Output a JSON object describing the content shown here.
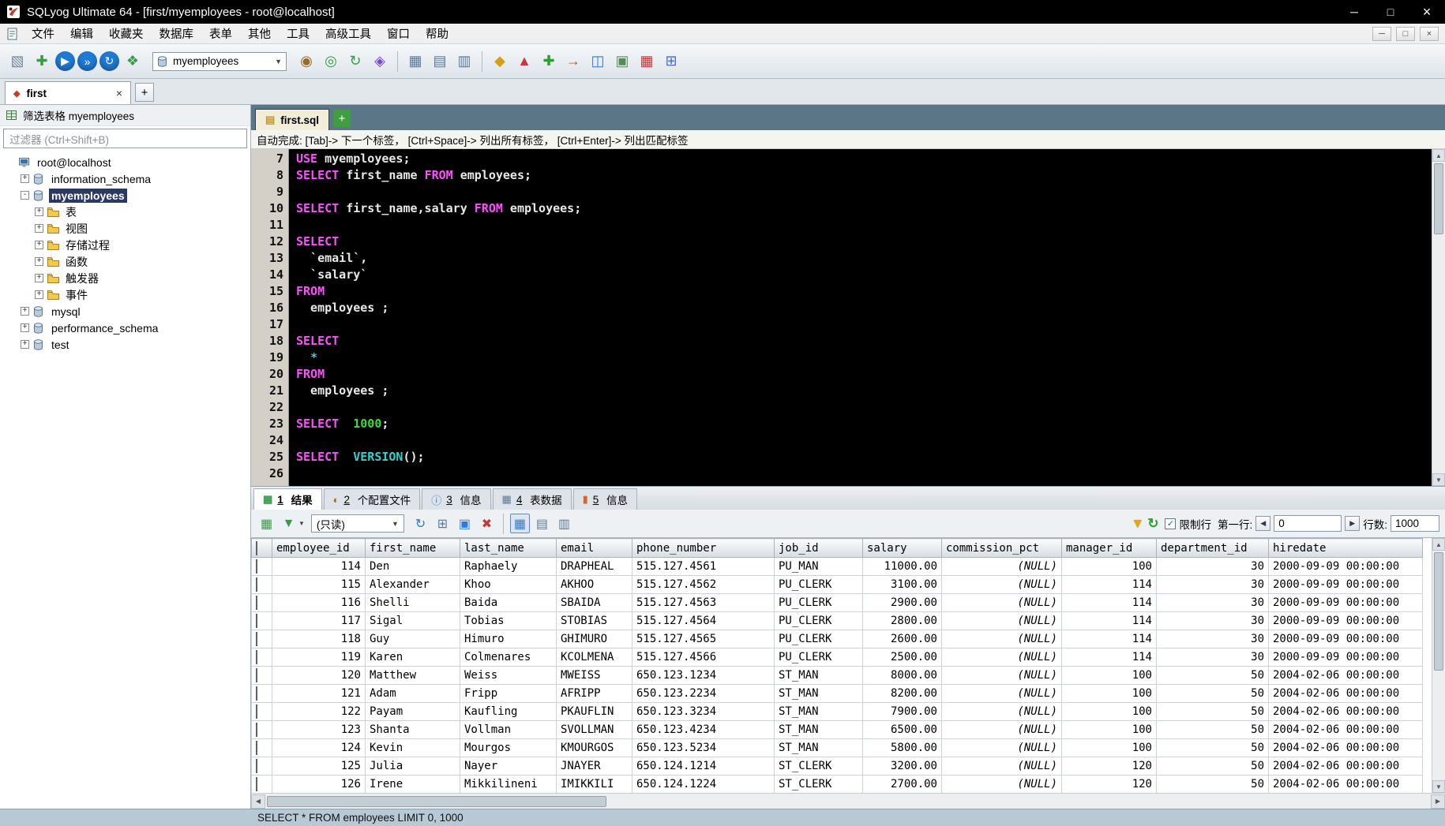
{
  "window": {
    "title": "SQLyog Ultimate 64 - [first/myemployees - root@localhost]",
    "controls": {
      "minimize": "─",
      "restore": "□",
      "close": "×"
    }
  },
  "menu": {
    "items": [
      "文件",
      "编辑",
      "收藏夹",
      "数据库",
      "表单",
      "其他",
      "工具",
      "高级工具",
      "窗口",
      "帮助"
    ]
  },
  "toolbar": {
    "db_selector": "myemployees",
    "left_icons": [
      {
        "name": "connection-manager-icon",
        "g": "▧",
        "c": "#76869a"
      },
      {
        "name": "new-query-editor-icon",
        "g": "✚",
        "c": "#3a9a4a"
      },
      {
        "name": "execute-query-icon",
        "g": "▶",
        "c": "#1f7ad4",
        "shape": "circle"
      },
      {
        "name": "execute-all-queries-icon",
        "g": "»",
        "c": "#1f7ad4",
        "shape": "circle"
      },
      {
        "name": "refresh-connection-icon",
        "g": "↻",
        "c": "#1f7ad4",
        "shape": "circle"
      },
      {
        "name": "user-manager-icon",
        "g": "❖",
        "c": "#3a9a4a"
      }
    ],
    "right_icons": [
      {
        "name": "query-profiler-icon",
        "g": "◉",
        "c": "#9a6a2a"
      },
      {
        "name": "connect-database-icon",
        "g": "◎",
        "c": "#3a9a4a"
      },
      {
        "name": "refresh-database-icon",
        "g": "↻",
        "c": "#3a9a4a"
      },
      {
        "name": "export-database-icon",
        "g": "◈",
        "c": "#7a4ad0"
      },
      {
        "sep": true
      },
      {
        "name": "create-table-icon",
        "g": "▦",
        "c": "#5a7a99"
      },
      {
        "name": "alter-table-icon",
        "g": "▤",
        "c": "#5a7a99"
      },
      {
        "name": "copy-table-icon",
        "g": "▥",
        "c": "#5a7a99"
      },
      {
        "sep": true
      },
      {
        "name": "query-builder-icon",
        "g": "◆",
        "c": "#d4a017"
      },
      {
        "name": "schema-designer-icon",
        "g": "▲",
        "c": "#c23a3a"
      },
      {
        "name": "data-sync-icon",
        "g": "✚",
        "c": "#2e9e2e"
      },
      {
        "name": "schema-sync-icon",
        "g": "→",
        "c": "#a0622a"
      },
      {
        "name": "visual-compare-icon",
        "g": "◫",
        "c": "#2e7ad4"
      },
      {
        "name": "notifications-icon",
        "g": "▣",
        "c": "#5a8a5a"
      },
      {
        "name": "scheduled-backup-icon",
        "g": "▦",
        "c": "#c23a3a"
      },
      {
        "name": "table-diagnostics-icon",
        "g": "⊞",
        "c": "#4a6acc"
      }
    ]
  },
  "session_tabs": {
    "tabs": [
      {
        "label": "first"
      }
    ],
    "new_tab": "+"
  },
  "sidebar": {
    "filter_label": "筛选表格 myemployees",
    "filter_placeholder": "过滤器 (Ctrl+Shift+B)",
    "tree": [
      {
        "label": "root@localhost",
        "type": "connection",
        "level": 0,
        "expand": ""
      },
      {
        "label": "information_schema",
        "type": "database",
        "level": 1,
        "expand": "+"
      },
      {
        "label": "myemployees",
        "type": "database",
        "level": 1,
        "expand": "-",
        "selected": true
      },
      {
        "label": "表",
        "type": "folder",
        "level": 2,
        "expand": "+"
      },
      {
        "label": "视图",
        "type": "folder",
        "level": 2,
        "expand": "+"
      },
      {
        "label": "存储过程",
        "type": "folder",
        "level": 2,
        "expand": "+"
      },
      {
        "label": "函数",
        "type": "folder",
        "level": 2,
        "expand": "+"
      },
      {
        "label": "触发器",
        "type": "folder",
        "level": 2,
        "expand": "+"
      },
      {
        "label": "事件",
        "type": "folder",
        "level": 2,
        "expand": "+"
      },
      {
        "label": "mysql",
        "type": "database",
        "level": 1,
        "expand": "+"
      },
      {
        "label": "performance_schema",
        "type": "database",
        "level": 1,
        "expand": "+"
      },
      {
        "label": "test",
        "type": "database",
        "level": 1,
        "expand": "+"
      }
    ]
  },
  "editor": {
    "tab_label": "first.sql",
    "new_tab": "+",
    "hint": "自动完成:  [Tab]-> 下一个标签， [Ctrl+Space]-> 列出所有标签， [Ctrl+Enter]-> 列出匹配标签",
    "token_colors": {
      "keyword": "#ff50ff",
      "text": "#e8e8e8",
      "number": "#3ddc3d",
      "function": "#2fd2d2"
    },
    "lines": [
      {
        "n": 7,
        "t": [
          [
            "kw",
            "USE"
          ],
          [
            "tx",
            " myemployees;"
          ]
        ]
      },
      {
        "n": 8,
        "t": [
          [
            "kw",
            "SELECT"
          ],
          [
            "tx",
            " first_name "
          ],
          [
            "kw",
            "FROM"
          ],
          [
            "tx",
            " employees;"
          ]
        ]
      },
      {
        "n": 9,
        "t": []
      },
      {
        "n": 10,
        "t": [
          [
            "kw",
            "SELECT"
          ],
          [
            "tx",
            " first_name,salary "
          ],
          [
            "kw",
            "FROM"
          ],
          [
            "tx",
            " employees;"
          ]
        ]
      },
      {
        "n": 11,
        "t": []
      },
      {
        "n": 12,
        "t": [
          [
            "kw",
            "SELECT"
          ]
        ]
      },
      {
        "n": 13,
        "t": [
          [
            "tx",
            "  `email`,"
          ]
        ]
      },
      {
        "n": 14,
        "t": [
          [
            "tx",
            "  `salary`"
          ]
        ]
      },
      {
        "n": 15,
        "t": [
          [
            "kw",
            "FROM"
          ]
        ]
      },
      {
        "n": 16,
        "t": [
          [
            "tx",
            "  employees ;"
          ]
        ]
      },
      {
        "n": 17,
        "t": []
      },
      {
        "n": 18,
        "t": [
          [
            "kw",
            "SELECT"
          ]
        ]
      },
      {
        "n": 19,
        "t": [
          [
            "tx",
            "  "
          ],
          [
            "st",
            "*"
          ]
        ]
      },
      {
        "n": 20,
        "t": [
          [
            "kw",
            "FROM"
          ]
        ]
      },
      {
        "n": 21,
        "t": [
          [
            "tx",
            "  employees ;"
          ]
        ]
      },
      {
        "n": 22,
        "t": []
      },
      {
        "n": 23,
        "t": [
          [
            "kw",
            "SELECT"
          ],
          [
            "tx",
            "  "
          ],
          [
            "num",
            "1000"
          ],
          [
            "tx",
            ";"
          ]
        ]
      },
      {
        "n": 24,
        "t": []
      },
      {
        "n": 25,
        "t": [
          [
            "kw",
            "SELECT"
          ],
          [
            "tx",
            "  "
          ],
          [
            "fn",
            "VERSION"
          ],
          [
            "tx",
            "();"
          ]
        ]
      },
      {
        "n": 26,
        "t": []
      }
    ]
  },
  "results": {
    "tabs": [
      {
        "num": "1",
        "label": "结果",
        "icon_g": "▦",
        "icon_c": "#3a9a4a",
        "active": true
      },
      {
        "num": "2",
        "label": "个配置文件",
        "icon_g": "◐",
        "icon_c": "#9a6a2a"
      },
      {
        "num": "3",
        "label": "信息",
        "icon_g": "ⓘ",
        "icon_c": "#2e7ad4"
      },
      {
        "num": "4",
        "label": "表数据",
        "icon_g": "▦",
        "icon_c": "#5a7a99"
      },
      {
        "num": "5",
        "label": "信息",
        "icon_g": "▮",
        "icon_c": "#d4682a"
      }
    ],
    "toolbar": {
      "left_icons": [
        {
          "name": "open-table-data-icon",
          "g": "▦",
          "c": "#3a9a4a"
        },
        {
          "name": "export-result-icon",
          "g": "▼",
          "c": "#3a9a4a",
          "caret": true
        }
      ],
      "mode": "(只读)",
      "mid_icons": [
        {
          "name": "refresh-result-icon",
          "g": "↻",
          "c": "#2e7ad4"
        },
        {
          "name": "add-row-icon",
          "g": "⊞",
          "c": "#5a7a99"
        },
        {
          "name": "save-changes-icon",
          "g": "▣",
          "c": "#2e7ad4"
        },
        {
          "name": "delete-row-icon",
          "g": "✖",
          "c": "#c23a3a"
        },
        {
          "sep": true
        },
        {
          "name": "grid-view-icon",
          "g": "▦",
          "c": "#2e7ad4",
          "active": true
        },
        {
          "name": "text-view-icon",
          "g": "▤",
          "c": "#5a7a99"
        },
        {
          "name": "form-view-icon",
          "g": "▥",
          "c": "#5a7a99"
        }
      ],
      "limit_label": "限制行",
      "first_row_label": "第一行:",
      "first_row_value": "0",
      "rows_label": "行数:",
      "rows_value": "1000"
    },
    "grid": {
      "columns": [
        "employee_id",
        "first_name",
        "last_name",
        "email",
        "phone_number",
        "job_id",
        "salary",
        "commission_pct",
        "manager_id",
        "department_id",
        "hiredate"
      ],
      "widths": [
        118,
        120,
        122,
        96,
        180,
        112,
        100,
        152,
        120,
        142,
        195
      ],
      "aligns": [
        "right",
        "left",
        "left",
        "left",
        "left",
        "left",
        "right",
        "right",
        "right",
        "right",
        "left"
      ],
      "rows": [
        [
          "114",
          "Den",
          "Raphaely",
          "DRAPHEAL",
          "515.127.4561",
          "PU_MAN",
          "11000.00",
          "(NULL)",
          "100",
          "30",
          "2000-09-09 00:00:00"
        ],
        [
          "115",
          "Alexander",
          "Khoo",
          "AKHOO",
          "515.127.4562",
          "PU_CLERK",
          "3100.00",
          "(NULL)",
          "114",
          "30",
          "2000-09-09 00:00:00"
        ],
        [
          "116",
          "Shelli",
          "Baida",
          "SBAIDA",
          "515.127.4563",
          "PU_CLERK",
          "2900.00",
          "(NULL)",
          "114",
          "30",
          "2000-09-09 00:00:00"
        ],
        [
          "117",
          "Sigal",
          "Tobias",
          "STOBIAS",
          "515.127.4564",
          "PU_CLERK",
          "2800.00",
          "(NULL)",
          "114",
          "30",
          "2000-09-09 00:00:00"
        ],
        [
          "118",
          "Guy",
          "Himuro",
          "GHIMURO",
          "515.127.4565",
          "PU_CLERK",
          "2600.00",
          "(NULL)",
          "114",
          "30",
          "2000-09-09 00:00:00"
        ],
        [
          "119",
          "Karen",
          "Colmenares",
          "KCOLMENA",
          "515.127.4566",
          "PU_CLERK",
          "2500.00",
          "(NULL)",
          "114",
          "30",
          "2000-09-09 00:00:00"
        ],
        [
          "120",
          "Matthew",
          "Weiss",
          "MWEISS",
          "650.123.1234",
          "ST_MAN",
          "8000.00",
          "(NULL)",
          "100",
          "50",
          "2004-02-06 00:00:00"
        ],
        [
          "121",
          "Adam",
          "Fripp",
          "AFRIPP",
          "650.123.2234",
          "ST_MAN",
          "8200.00",
          "(NULL)",
          "100",
          "50",
          "2004-02-06 00:00:00"
        ],
        [
          "122",
          "Payam",
          "Kaufling",
          "PKAUFLIN",
          "650.123.3234",
          "ST_MAN",
          "7900.00",
          "(NULL)",
          "100",
          "50",
          "2004-02-06 00:00:00"
        ],
        [
          "123",
          "Shanta",
          "Vollman",
          "SVOLLMAN",
          "650.123.4234",
          "ST_MAN",
          "6500.00",
          "(NULL)",
          "100",
          "50",
          "2004-02-06 00:00:00"
        ],
        [
          "124",
          "Kevin",
          "Mourgos",
          "KMOURGOS",
          "650.123.5234",
          "ST_MAN",
          "5800.00",
          "(NULL)",
          "100",
          "50",
          "2004-02-06 00:00:00"
        ],
        [
          "125",
          "Julia",
          "Nayer",
          "JNAYER",
          "650.124.1214",
          "ST_CLERK",
          "3200.00",
          "(NULL)",
          "120",
          "50",
          "2004-02-06 00:00:00"
        ],
        [
          "126",
          "Irene",
          "Mikkilineni",
          "IMIKKILI",
          "650.124.1224",
          "ST_CLERK",
          "2700.00",
          "(NULL)",
          "120",
          "50",
          "2004-02-06 00:00:00"
        ]
      ]
    }
  },
  "status_bar": {
    "text": "SELECT * FROM employees LIMIT 0, 1000"
  }
}
